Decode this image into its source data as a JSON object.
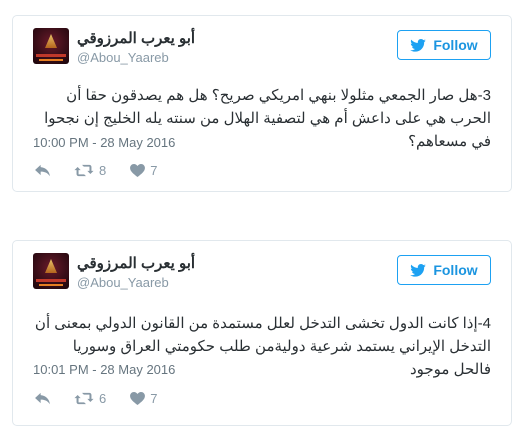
{
  "tweets": [
    {
      "display_name": "أبو يعرب المرزوقي",
      "handle": "@Abou_Yaareb",
      "follow_label": "Follow",
      "text": "3-هل صار الجمعي مثلولا بنهي امريكي صريح؟ هل هم يصدقون حقا أن الحرب هي على داعش أم هي لتصفية الهلال من سنته يله الخليج إن نجحوا في مسعاهم؟",
      "timestamp": "10:00 PM - 28 May 2016",
      "retweets": "8",
      "likes": "7"
    },
    {
      "display_name": "أبو يعرب المرزوقي",
      "handle": "@Abou_Yaareb",
      "follow_label": "Follow",
      "text": "4-إذا كانت الدول تخشى التدخل لعلل مستمدة من القانون الدولي بمعنى أن التدخل الإيراني يستمد شرعية دوليةمن طلب حكومتي العراق وسوريا فالحل موجود",
      "timestamp": "10:01 PM - 28 May 2016",
      "retweets": "6",
      "likes": "7"
    }
  ],
  "icons": {
    "reply": "reply-icon",
    "retweet": "retweet-icon",
    "like": "heart-icon",
    "follow": "twitter-bird-icon"
  },
  "colors": {
    "accent": "#1da1f2",
    "border": "#e1e8ed",
    "muted": "#8899a6"
  }
}
